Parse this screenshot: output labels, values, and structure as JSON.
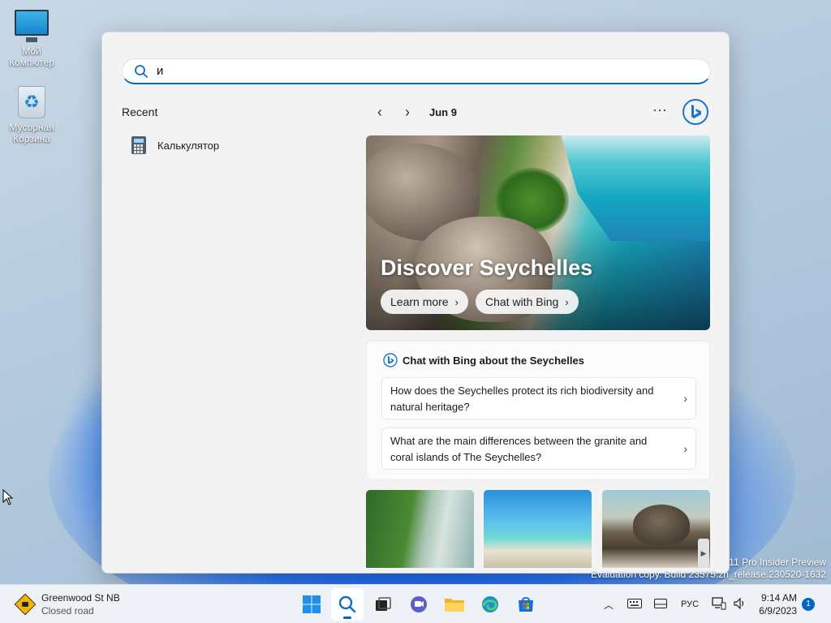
{
  "desktop": {
    "icons": [
      {
        "label": "Мой Компютер",
        "icon": "computer-icon"
      },
      {
        "label": "Мусорная Корзина",
        "icon": "recycle-bin-icon"
      }
    ],
    "watermark": {
      "line1": "11 Pro Insider Preview",
      "line2": "Evaluation copy. Build 23575.zn_release.230520-1632"
    }
  },
  "search": {
    "query": "и",
    "recent_title": "Recent",
    "recent_items": [
      {
        "label": "Калькулятор",
        "icon": "calculator-icon"
      }
    ],
    "nav": {
      "date": "Jun 9",
      "prev_icon": "chevron-left-icon",
      "next_icon": "chevron-right-icon",
      "more_icon": "more-icon",
      "bing_icon": "bing-icon"
    },
    "hero": {
      "title": "Discover Seychelles",
      "learn_more": "Learn more",
      "chat_with_bing": "Chat with Bing"
    },
    "chat": {
      "heading": "Chat with Bing about the Seychelles",
      "questions": [
        "How does the Seychelles protect its rich biodiversity and natural heritage?",
        "What are the main differences between the granite and coral islands of The Seychelles?"
      ]
    }
  },
  "taskbar": {
    "weather": {
      "line1": "Greenwood St NB",
      "line2": "Closed road"
    },
    "apps": [
      "start-icon",
      "search-icon",
      "task-view-icon",
      "chat-icon",
      "file-explorer-icon",
      "edge-icon",
      "store-icon"
    ],
    "tray": {
      "language": "РУС"
    },
    "clock": {
      "time": "9:14 AM",
      "date": "6/9/2023"
    },
    "notifications": "1"
  },
  "colors": {
    "accent": "#0067c0",
    "panel": "#f3f3f3",
    "taskbar": "#eef2f6"
  }
}
